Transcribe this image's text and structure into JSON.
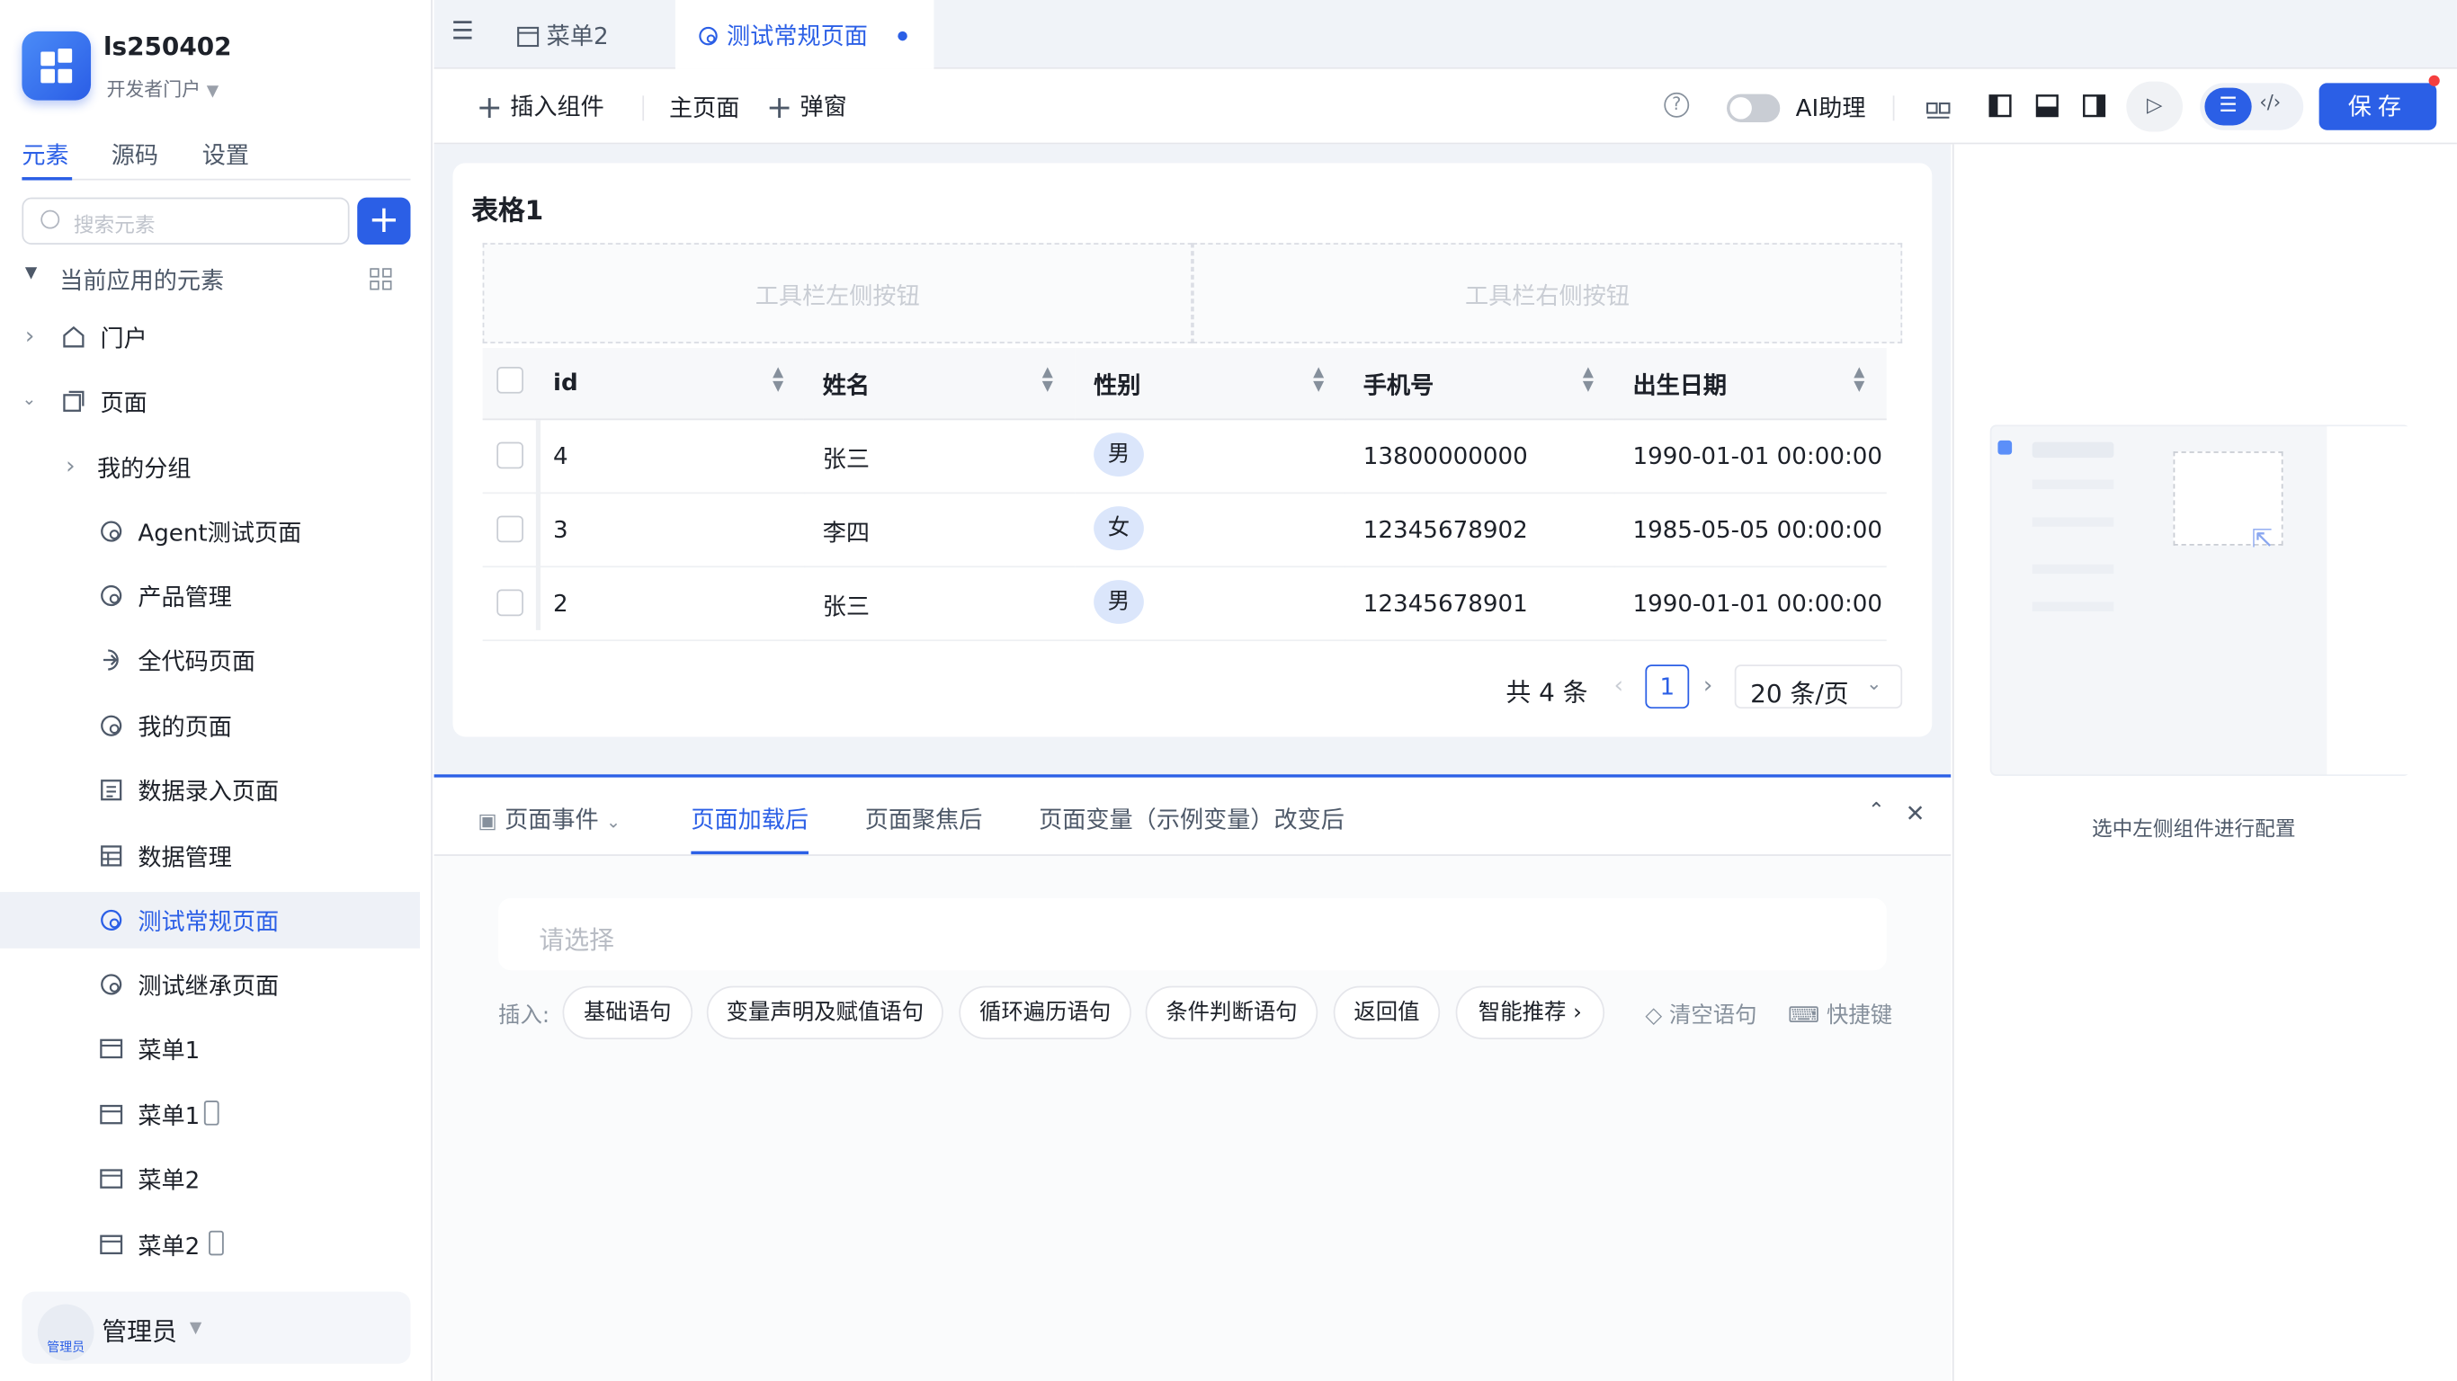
{
  "app": {
    "name": "ls250402",
    "portal": "开发者门户"
  },
  "sidebar": {
    "tabs": [
      "元素",
      "源码",
      "设置"
    ],
    "search_placeholder": "搜索元素",
    "section_title": "当前应用的元素",
    "tree": [
      {
        "label": "门户",
        "icon": "home-icon"
      },
      {
        "label": "页面",
        "icon": "pages-icon"
      },
      {
        "label": "我的分组",
        "icon": "chevron-right-icon"
      },
      {
        "label": "Agent测试页面",
        "icon": "page-icon"
      },
      {
        "label": "产品管理",
        "icon": "page-icon"
      },
      {
        "label": "全代码页面",
        "icon": "code-page-icon"
      },
      {
        "label": "我的页面",
        "icon": "page-icon"
      },
      {
        "label": "数据录入页面",
        "icon": "form-icon"
      },
      {
        "label": "数据管理",
        "icon": "table-icon"
      },
      {
        "label": "测试常规页面",
        "icon": "page-icon"
      },
      {
        "label": "测试继承页面",
        "icon": "page-icon"
      },
      {
        "label": "菜单1",
        "icon": "menu-icon"
      },
      {
        "label": "菜单1",
        "icon": "menu-icon"
      },
      {
        "label": "菜单2",
        "icon": "menu-icon"
      },
      {
        "label": "菜单2",
        "icon": "menu-icon"
      }
    ],
    "user": {
      "name": "管理员",
      "avatar_label": "管理员"
    }
  },
  "page_tabs": [
    {
      "label": "菜单2"
    },
    {
      "label": "测试常规页面"
    }
  ],
  "toolbar": {
    "insert_component": "插入组件",
    "main_page": "主页面",
    "popup": "弹窗",
    "ai_assistant": "AI助理",
    "save": "保存"
  },
  "table": {
    "title": "表格1",
    "toolbar_left": "工具栏左侧按钮",
    "toolbar_right": "工具栏右侧按钮",
    "columns": [
      "id",
      "姓名",
      "性别",
      "手机号",
      "出生日期"
    ],
    "rows": [
      {
        "id": "4",
        "name": "张三",
        "gender": "男",
        "phone": "13800000000",
        "birth": "1990-01-01 00:00:00"
      },
      {
        "id": "3",
        "name": "李四",
        "gender": "女",
        "phone": "12345678902",
        "birth": "1985-05-05 00:00:00"
      },
      {
        "id": "2",
        "name": "张三",
        "gender": "男",
        "phone": "12345678901",
        "birth": "1990-01-01 00:00:00"
      }
    ],
    "total": "共 4 条",
    "current_page": "1",
    "page_size": "20 条/页"
  },
  "events": {
    "dropdown": "页面事件",
    "tabs": [
      "页面加载后",
      "页面聚焦后",
      "页面变量（示例变量）改变后"
    ],
    "select_placeholder": "请选择",
    "insert_label": "插入:",
    "chips": [
      "基础语句",
      "变量声明及赋值语句",
      "循环遍历语句",
      "条件判断语句",
      "返回值",
      "智能推荐 ›"
    ],
    "clear": "清空语句",
    "shortcut": "快捷键"
  },
  "right_panel": {
    "hint": "选中左侧组件进行配置"
  },
  "colors": {
    "accent": "#2b5fe6",
    "selected_bg": "#eef1f7"
  }
}
